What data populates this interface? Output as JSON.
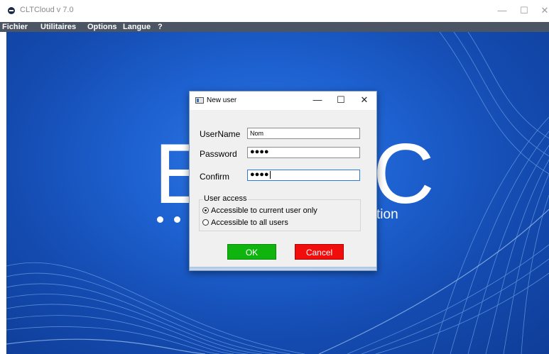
{
  "app": {
    "title": "CLTCloud v 7.0",
    "controls": {
      "minimize": "—",
      "maximize": "☐",
      "close": "✕"
    }
  },
  "menu": [
    "Fichier",
    "Utilitaires",
    "Options",
    "Langue",
    "?"
  ],
  "background": {
    "letter_left": "E",
    "letter_right": "C",
    "tagline": "tion"
  },
  "dialog": {
    "title": "New user",
    "controls": {
      "minimize": "—",
      "maximize": "☐",
      "close": "✕"
    },
    "fields": [
      {
        "label": "UserName",
        "value": "Nom"
      },
      {
        "label": "Password",
        "value": "●●●●"
      },
      {
        "label": "Confirm",
        "value": "●●●●"
      }
    ],
    "user_access": {
      "title": "User access",
      "options": [
        {
          "label": "Accessible to current user only",
          "selected": true
        },
        {
          "label": "Accessible to all users",
          "selected": false
        }
      ]
    },
    "buttons": {
      "ok": "OK",
      "cancel": "Cancel"
    }
  },
  "colors": {
    "menubar": "#4b5563",
    "background": "#1d60cf",
    "ok_button": "#0fb40f",
    "cancel_button": "#f20d0d"
  }
}
